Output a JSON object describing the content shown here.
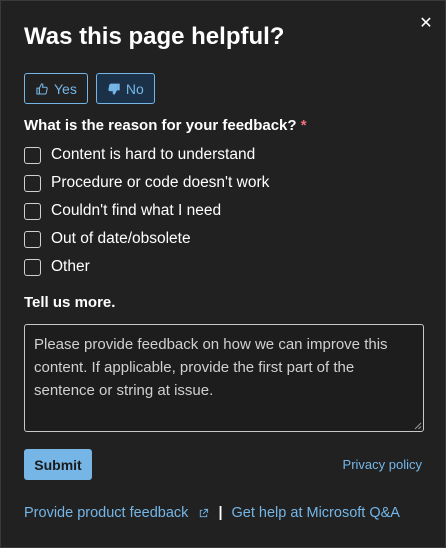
{
  "dialog": {
    "title": "Was this page helpful?",
    "close_icon": "close-icon"
  },
  "vote": {
    "yes_label": "Yes",
    "yes_icon": "thumbs-up-icon",
    "no_label": "No",
    "no_icon": "thumbs-down-icon",
    "selected": "No"
  },
  "reason": {
    "question": "What is the reason for your feedback?",
    "required_mark": "*",
    "options": [
      {
        "label": "Content is hard to understand",
        "checked": false
      },
      {
        "label": "Procedure or code doesn't work",
        "checked": false
      },
      {
        "label": "Couldn't find what I need",
        "checked": false
      },
      {
        "label": "Out of date/obsolete",
        "checked": false
      },
      {
        "label": "Other",
        "checked": false
      }
    ]
  },
  "more": {
    "label": "Tell us more.",
    "placeholder": "Please provide feedback on how we can improve this content. If applicable, provide the first part of the sentence or string at issue.",
    "value": ""
  },
  "actions": {
    "submit_label": "Submit",
    "privacy_label": "Privacy policy"
  },
  "footer": {
    "product_feedback_label": "Provide product feedback",
    "product_feedback_icon": "external-link-icon",
    "separator": "|",
    "help_label": "Get help at Microsoft Q&A"
  },
  "colors": {
    "background": "#212121",
    "accent": "#75b6e7",
    "required": "#f1707b"
  }
}
